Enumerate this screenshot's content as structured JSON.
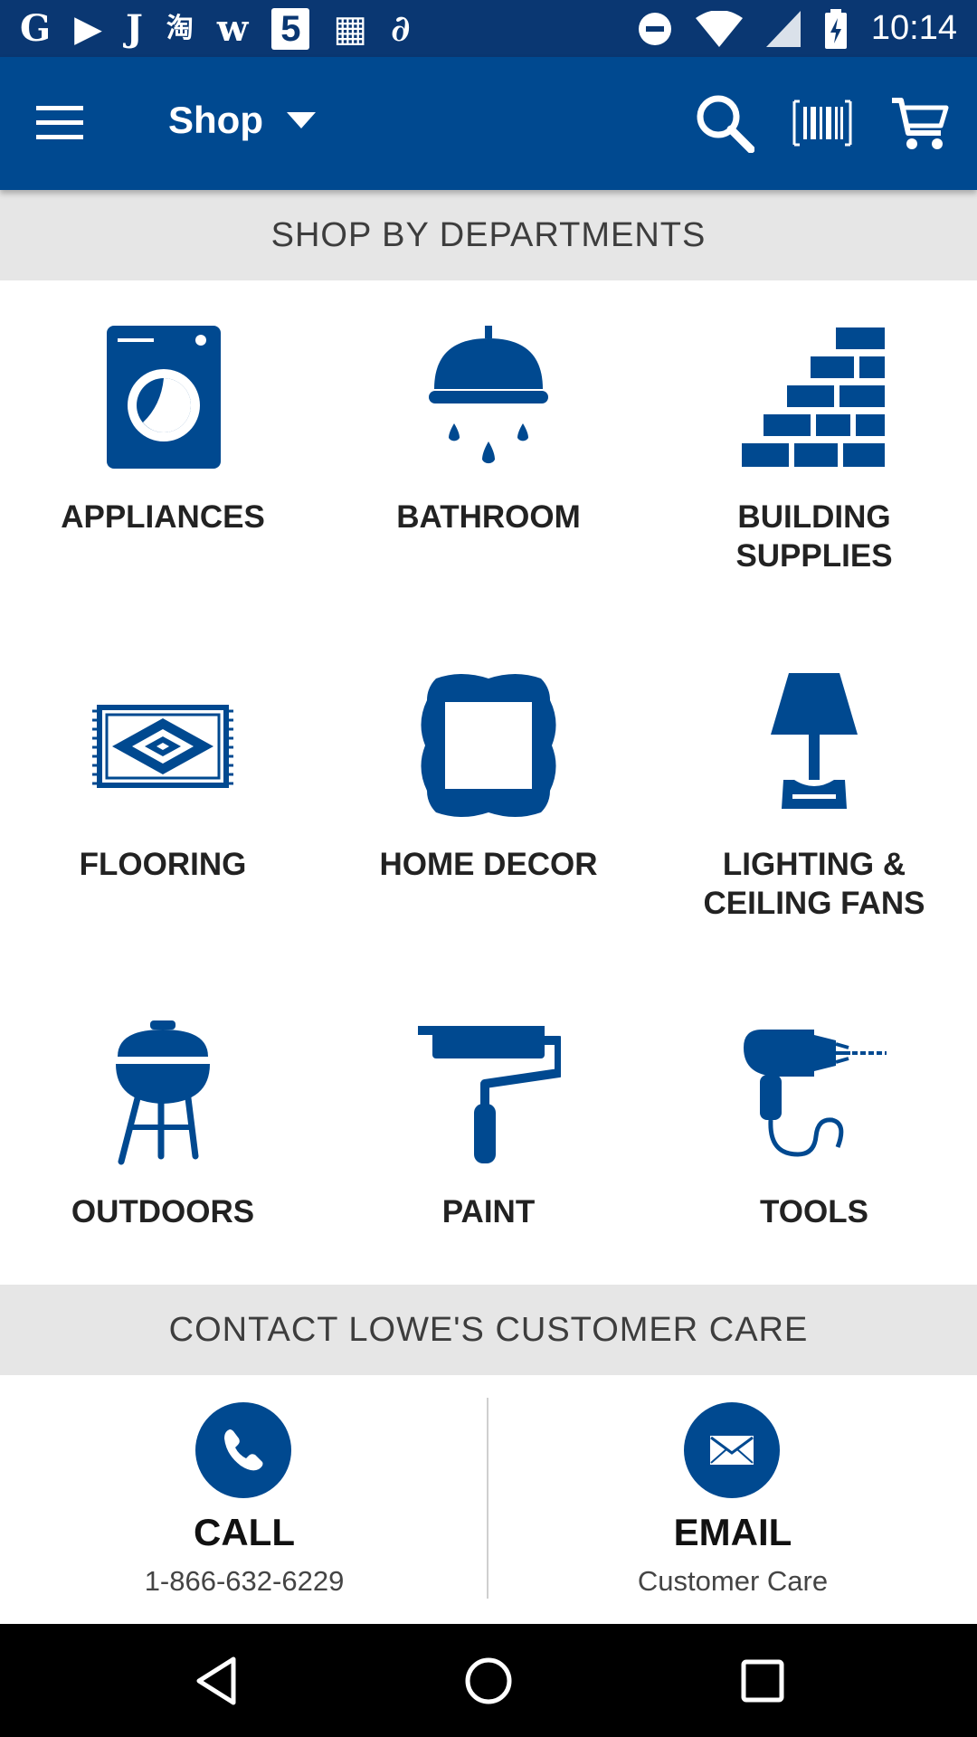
{
  "status_bar": {
    "left_icons": [
      "google-g-icon",
      "drive-icon",
      "j-app-icon",
      "taobao-icon",
      "w-app-icon",
      "five-app-icon",
      "grid-app-icon",
      "link-app-icon"
    ],
    "left_glyphs": [
      "G",
      "▶",
      "J",
      "淘",
      "w",
      "5",
      "▦",
      "∂"
    ],
    "right_icons": [
      "do-not-disturb-icon",
      "wifi-icon",
      "signal-icon",
      "battery-charging-icon"
    ],
    "time": "10:14"
  },
  "app_bar": {
    "title": "Shop",
    "background": "#004990",
    "actions": [
      "search-icon",
      "barcode-scan-icon",
      "cart-icon"
    ]
  },
  "departments": {
    "header": "SHOP BY DEPARTMENTS",
    "items": [
      {
        "label": "APPLIANCES",
        "icon": "washer-icon"
      },
      {
        "label": "BATHROOM",
        "icon": "shower-head-icon"
      },
      {
        "label": "BUILDING\nSUPPLIES",
        "icon": "brick-wall-icon"
      },
      {
        "label": "FLOORING",
        "icon": "rug-icon"
      },
      {
        "label": "HOME DECOR",
        "icon": "picture-frame-icon"
      },
      {
        "label": "LIGHTING &\nCEILING FANS",
        "icon": "lamp-icon"
      },
      {
        "label": "OUTDOORS",
        "icon": "grill-icon"
      },
      {
        "label": "PAINT",
        "icon": "paint-roller-icon"
      },
      {
        "label": "TOOLS",
        "icon": "drill-icon"
      }
    ]
  },
  "contact": {
    "header": "CONTACT LOWE'S CUSTOMER CARE",
    "call": {
      "title": "CALL",
      "subtitle": "1-866-632-6229",
      "icon": "phone-icon"
    },
    "email": {
      "title": "EMAIL",
      "subtitle": "Customer Care",
      "icon": "envelope-icon"
    }
  },
  "nav_bar": {
    "buttons": [
      "back-icon",
      "home-icon",
      "recents-icon"
    ]
  },
  "colors": {
    "brand_blue": "#004990",
    "status_blue": "#0a3772",
    "section_gray": "#e6e6e6"
  }
}
